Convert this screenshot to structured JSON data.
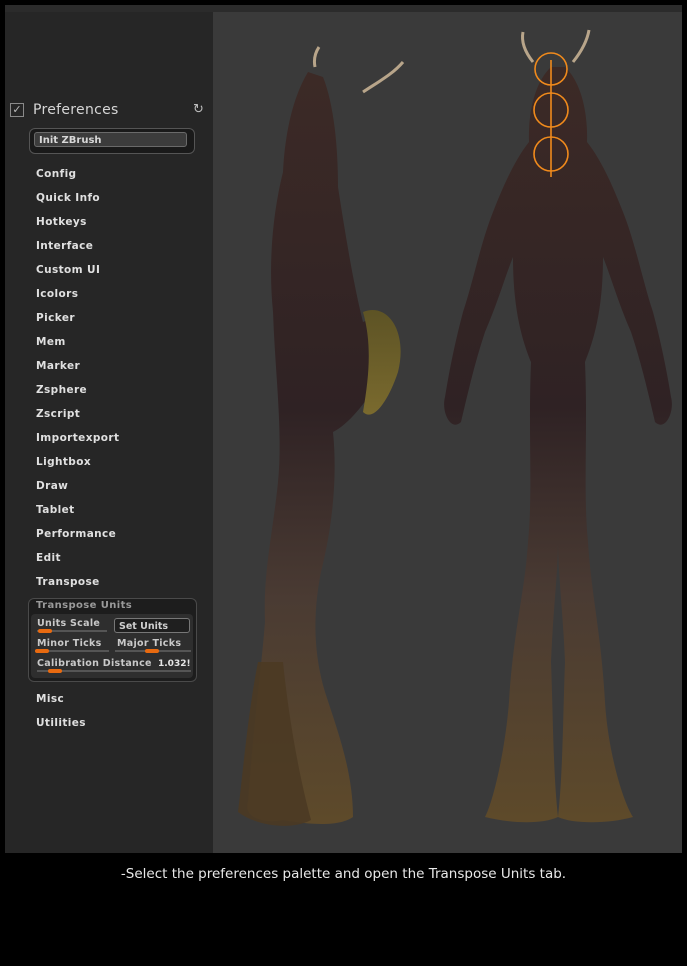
{
  "palette": {
    "title": "Preferences",
    "init_button": "Init ZBrush",
    "items": [
      "Config",
      "Quick Info",
      "Hotkeys",
      "Interface",
      "Custom UI",
      "Icolors",
      "Picker",
      "Mem",
      "Marker",
      "Zsphere",
      "Zscript",
      "Importexport",
      "Lightbox",
      "Draw",
      "Tablet",
      "Performance",
      "Edit",
      "Transpose"
    ],
    "transpose_units": {
      "title": "Transpose Units",
      "units_scale": "Units Scale",
      "set_units": "Set Units",
      "minor_ticks": "Minor Ticks",
      "major_ticks": "Major Ticks",
      "calibration_distance": "Calibration Distance",
      "calibration_value": "1.032!"
    },
    "after_items": [
      "Misc",
      "Utilities"
    ]
  },
  "caption": "-Select the preferences palette and open the Transpose Units tab."
}
